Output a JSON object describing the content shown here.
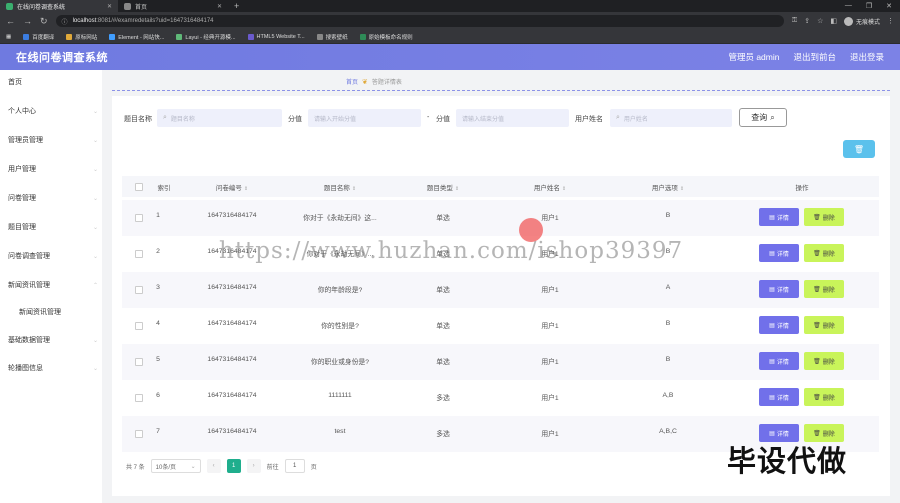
{
  "browser": {
    "tabs": [
      {
        "label": "在线问卷调查系统",
        "active": true,
        "favicon_color": "#3aaf6e"
      },
      {
        "label": "首页",
        "active": false,
        "favicon_color": "#888888"
      }
    ],
    "url_host": "localhost",
    "url_rest": ":8081/#/examredetails?uid=1647316484174",
    "profile_label": "无痕模式",
    "bookmarks": [
      {
        "label": "百度翻译",
        "color": "#3b7de0"
      },
      {
        "label": "原标网站",
        "color": "#e0a93a"
      },
      {
        "label": "Element - 网站快...",
        "color": "#409eff"
      },
      {
        "label": "Layui - 经典开源模...",
        "color": "#5fb878"
      },
      {
        "label": "HTML5 Website T...",
        "color": "#6a5acd"
      },
      {
        "label": "搜索壁纸",
        "color": "#888888"
      },
      {
        "label": "原始模板命名规则",
        "color": "#2e8b57"
      }
    ]
  },
  "app": {
    "title": "在线问卷调查系统",
    "header_links": [
      "管理员 admin",
      "退出到前台",
      "退出登录"
    ]
  },
  "sidebar": {
    "items": [
      {
        "label": "首页",
        "has_arrow": false
      },
      {
        "label": "个人中心",
        "has_arrow": true
      },
      {
        "label": "管理员管理",
        "has_arrow": true
      },
      {
        "label": "用户管理",
        "has_arrow": true
      },
      {
        "label": "问卷管理",
        "has_arrow": true
      },
      {
        "label": "题目管理",
        "has_arrow": true
      },
      {
        "label": "问卷调查管理",
        "has_arrow": true
      },
      {
        "label": "新闻资讯管理",
        "has_arrow": true
      },
      {
        "label": "新闻资讯管理",
        "has_arrow": false,
        "sub": true
      },
      {
        "label": "基础数据管理",
        "has_arrow": true
      },
      {
        "label": "轮播图信息",
        "has_arrow": true
      }
    ]
  },
  "breadcrumb": {
    "home": "首页",
    "current": "答题详情表"
  },
  "filters": {
    "title_label": "题目名称",
    "title_placeholder": "题目名称",
    "score_label": "分值",
    "score_start_placeholder": "请输入开始分值",
    "dash": "-",
    "score_label2": "分值",
    "score_end_placeholder": "请输入结束分值",
    "user_label": "用户姓名",
    "user_placeholder": "用户姓名",
    "query_button": "查询"
  },
  "table": {
    "headers": [
      "索引",
      "问卷编号",
      "题目名称",
      "题目类型",
      "用户姓名",
      "用户选项",
      "操作"
    ],
    "detail_label": "详情",
    "delete_label": "删除",
    "rows": [
      {
        "idx": "1",
        "code": "1647316484174",
        "title": "你对于《永劫无间》这...",
        "type": "单选",
        "user": "用户1",
        "option": "B"
      },
      {
        "idx": "2",
        "code": "1647316484174",
        "title": "你对于《永劫无间》...",
        "type": "单选",
        "user": "用户1",
        "option": "B"
      },
      {
        "idx": "3",
        "code": "1647316484174",
        "title": "你的年龄段是?",
        "type": "单选",
        "user": "用户1",
        "option": "A"
      },
      {
        "idx": "4",
        "code": "1647316484174",
        "title": "你的性别是?",
        "type": "单选",
        "user": "用户1",
        "option": "B"
      },
      {
        "idx": "5",
        "code": "1647316484174",
        "title": "你的职业或身份是?",
        "type": "单选",
        "user": "用户1",
        "option": "B"
      },
      {
        "idx": "6",
        "code": "1647316484174",
        "title": "1111111",
        "type": "多选",
        "user": "用户1",
        "option": "A,B"
      },
      {
        "idx": "7",
        "code": "1647316484174",
        "title": "test",
        "type": "多选",
        "user": "用户1",
        "option": "A,B,C"
      }
    ]
  },
  "pager": {
    "total": "共 7 条",
    "page_size": "10条/页",
    "current_page": "1",
    "goto_label": "前往",
    "goto_value": "1",
    "page_suffix": "页"
  },
  "overlay": {
    "watermark": "https://www.huzhan.com/ishop39397",
    "stamp": "毕设代做"
  }
}
